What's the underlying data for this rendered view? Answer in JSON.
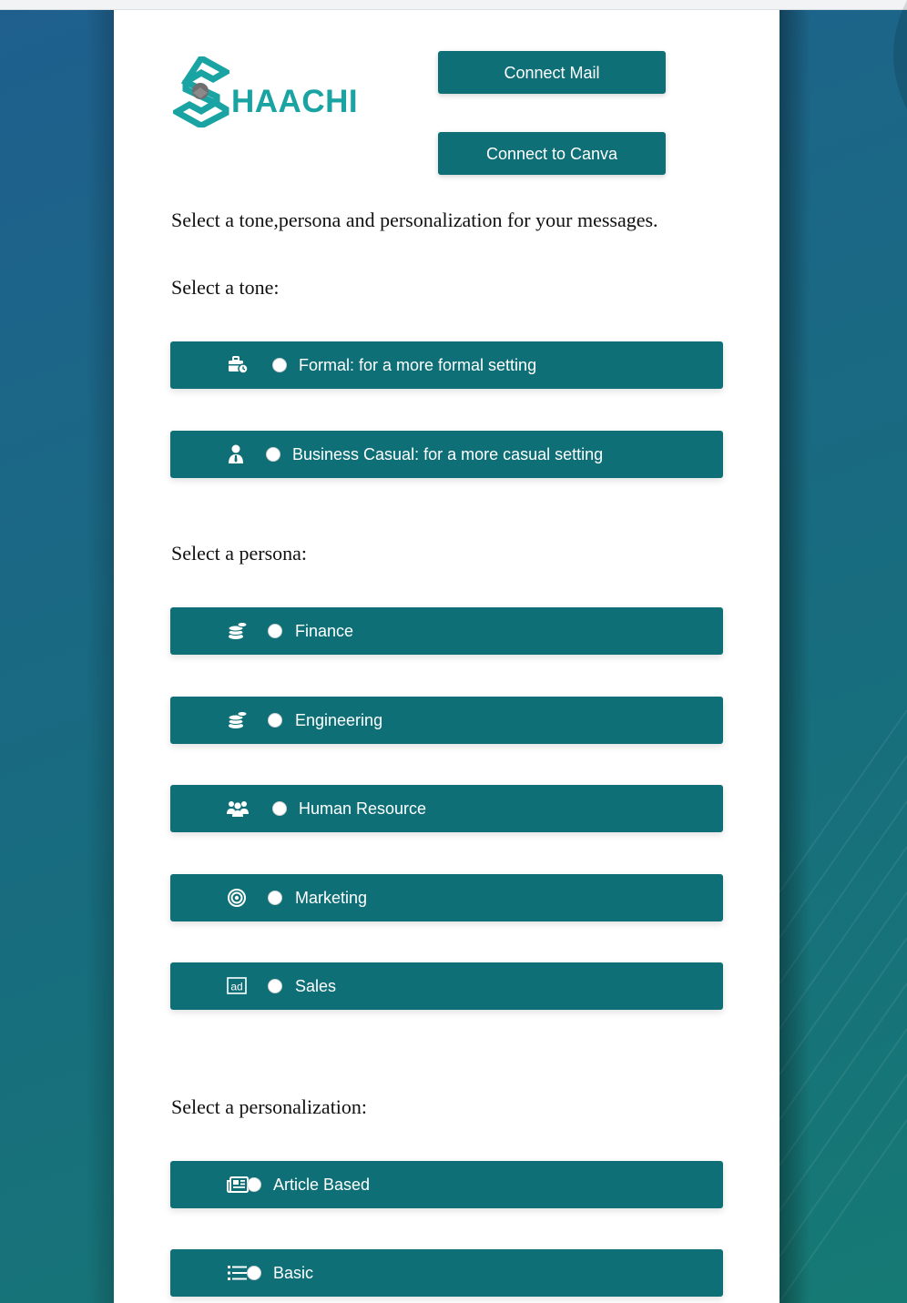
{
  "header": {
    "logo_text": "HAACHI",
    "connect_mail_label": "Connect Mail",
    "connect_canva_label": "Connect to Canva"
  },
  "intro_text": "Select a tone,persona and personalization for your messages.",
  "tone": {
    "label": "Select a tone:",
    "options": [
      {
        "label": "Formal: for a more formal setting",
        "icon": "briefcase-clock-icon"
      },
      {
        "label": "Business Casual: for a more casual setting",
        "icon": "user-tie-icon"
      }
    ]
  },
  "persona": {
    "label": "Select a persona:",
    "options": [
      {
        "label": "Finance",
        "icon": "coins-icon"
      },
      {
        "label": "Engineering",
        "icon": "coins-icon"
      },
      {
        "label": "Human Resource",
        "icon": "users-icon"
      },
      {
        "label": "Marketing",
        "icon": "target-icon"
      },
      {
        "label": "Sales",
        "icon": "ad-icon"
      }
    ]
  },
  "personalization": {
    "label": "Select a personalization:",
    "options": [
      {
        "label": "Article Based",
        "icon": "newspaper-icon"
      },
      {
        "label": "Basic",
        "icon": "list-icon"
      }
    ]
  },
  "colors": {
    "accent": "#0f6f77",
    "logo": "#1aa3a3",
    "background_start": "#1f5f8e",
    "background_end": "#167a74"
  }
}
